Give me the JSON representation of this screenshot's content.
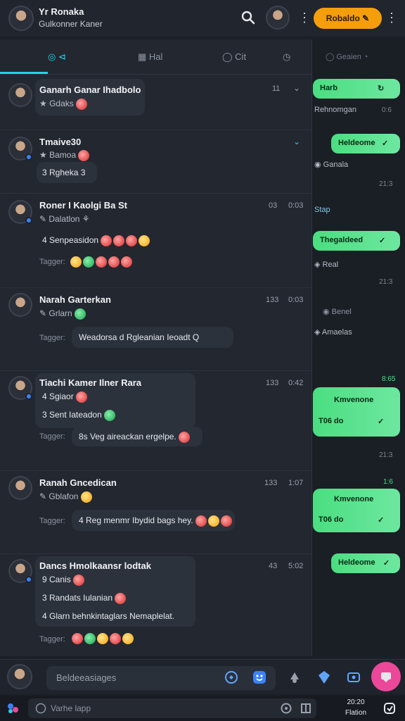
{
  "topbar": {
    "name": "Yr Ronaka",
    "status": "Gulkonner Kaner",
    "cta": "Robaldo"
  },
  "tabs": [
    {
      "label": ""
    },
    {
      "label": "Hal"
    },
    {
      "label": "Cit"
    }
  ],
  "chats": [
    {
      "name": "Ganarh Ganar Ihadbolo",
      "sub": "Gdaks",
      "count": "11"
    },
    {
      "name": "Tmaive30",
      "sub": "Bamoa",
      "bubble": "3 Rgheka 3"
    },
    {
      "name": "Roner I Kaolgi Ba St",
      "sub": "Dalatlon",
      "count": "03",
      "time": "0:03",
      "bubble": "4 Senpeasidon",
      "tag": "Tagger:"
    },
    {
      "name": "Narah Garterkan",
      "sub": "Grlarn",
      "count": "133",
      "time": "0:03",
      "tag": "Tagger:",
      "bubble": "Weadorsa d Rgleanian Ieoadt Q"
    },
    {
      "name": "Tiachi Kamer Ilner Rara",
      "count": "133",
      "time": "0:42",
      "bubble1": "4 Sgiaor",
      "bubble2": "3 Sent Iateadon",
      "tag": "Tagger:",
      "bubble3": "8s Veg aireackan ergelpe."
    },
    {
      "name": "Ranah Gncedican",
      "sub": "Gblafon",
      "count": "133",
      "time": "1:07",
      "tag": "Tagger:",
      "bubble": "4 Reg menmr Ibydid bags hey."
    },
    {
      "name": "Dancs Hmolkaansr lodtak",
      "count": "43",
      "time": "5:02",
      "bubble1": "9 Canis",
      "bubble2": "3 Randats Iulanian",
      "bubble3": "4 Glarn behnkintaglars Nemaplelat.",
      "tag": "Tagger:"
    }
  ],
  "right": {
    "search": "Geaien",
    "items": [
      {
        "kind": "bubble",
        "text": "Harb"
      },
      {
        "kind": "text",
        "text": "Rehnomgan",
        "time": "0:6"
      },
      {
        "kind": "bubble",
        "text": "Heldeome"
      },
      {
        "kind": "text",
        "text": "Ganala"
      },
      {
        "kind": "time",
        "text": "21:3"
      },
      {
        "kind": "text",
        "text": "Stap"
      },
      {
        "kind": "bubble",
        "text": "Thegaldeed"
      },
      {
        "kind": "text",
        "text": "Real"
      },
      {
        "kind": "time",
        "text": "21:3"
      },
      {
        "kind": "text",
        "text": "Benel"
      },
      {
        "kind": "text",
        "text": "Amaelas"
      },
      {
        "kind": "time",
        "text": "8:65"
      },
      {
        "kind": "bubble",
        "text": "Kmvenone",
        "sub": "T06 do"
      },
      {
        "kind": "time",
        "text": "21:3"
      },
      {
        "kind": "time",
        "text": "1:6"
      },
      {
        "kind": "bubble",
        "text": "Kmvenone",
        "sub": "T06 do"
      },
      {
        "kind": "bubble",
        "text": "Heldeome"
      }
    ]
  },
  "composer": {
    "placeholder": "Beldeeasiages"
  },
  "bottom": {
    "placeholder": "Varhe lapp",
    "time": "20:20",
    "date": "Flation"
  }
}
